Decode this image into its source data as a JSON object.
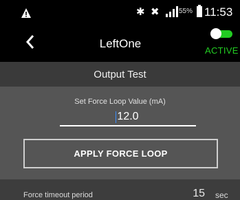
{
  "status_bar": {
    "battery_percent": "55%",
    "time": "11:53",
    "icons": [
      "warning-icon",
      "bluetooth-icon",
      "mute-icon",
      "signal-icon",
      "battery-icon"
    ]
  },
  "app_bar": {
    "title": "LeftOne",
    "toggle_state": "on",
    "toggle_color": "#22cc22",
    "status_label": "ACTIVE"
  },
  "section": {
    "title": "Output Test"
  },
  "force_loop": {
    "label": "Set Force Loop Value (mA)",
    "value": "12.0",
    "apply_label": "APPLY FORCE LOOP"
  },
  "timeout": {
    "label": "Force timeout period",
    "value": "15",
    "unit": "sec"
  }
}
